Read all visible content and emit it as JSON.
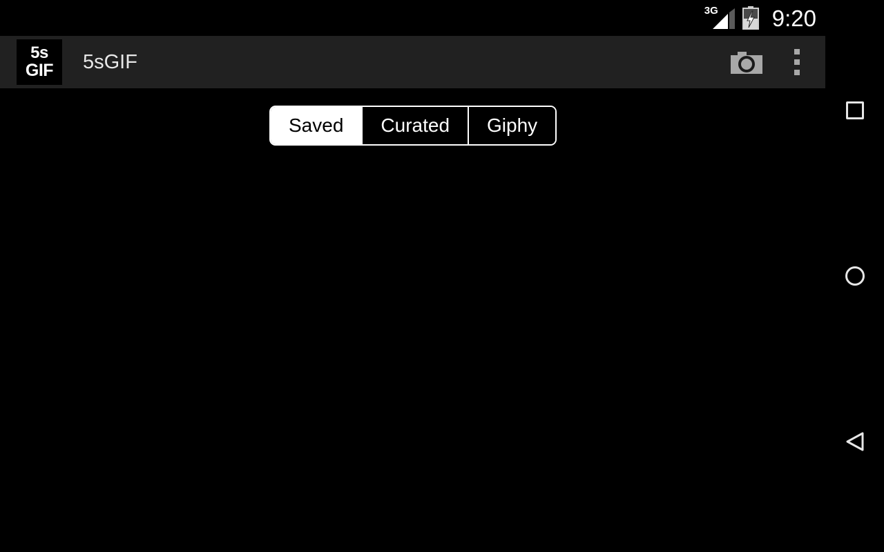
{
  "status_bar": {
    "network_label": "3G",
    "signal_icon": "signal-triangle-icon",
    "battery_icon": "battery-charging-icon",
    "clock": "9:20"
  },
  "app_bar": {
    "logo_line1": "5s",
    "logo_line2": "GIF",
    "title": "5sGIF",
    "camera_icon": "camera-icon",
    "overflow_icon": "overflow-menu-icon"
  },
  "content": {
    "tabs": [
      {
        "label": "Saved",
        "selected": true
      },
      {
        "label": "Curated",
        "selected": false
      },
      {
        "label": "Giphy",
        "selected": false
      }
    ],
    "empty_state_text": ""
  },
  "nav_bar": {
    "recents_icon": "square-recents-icon",
    "home_icon": "circle-home-icon",
    "back_icon": "triangle-back-icon"
  },
  "colors": {
    "background": "#000000",
    "app_bar": "#212121",
    "accent": "#ffffff",
    "icon_grey": "#a8a8a8"
  }
}
